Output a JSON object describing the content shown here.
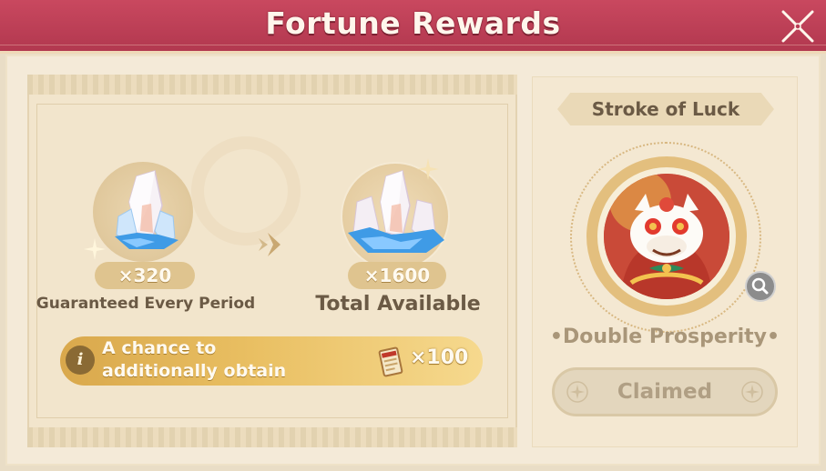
{
  "window": {
    "title": "Fortune Rewards"
  },
  "icons": {
    "close": "close-x-icon",
    "info": "info-icon",
    "arrow": "chevron-right-icon",
    "magnify": "magnifier-icon",
    "ticket": "ticket-icon",
    "crystal": "crystal-icon"
  },
  "rewards": {
    "guaranteed": {
      "amount": "×320",
      "caption": "Guaranteed Every Period"
    },
    "total": {
      "amount": "×1600",
      "caption": "Total Available"
    },
    "chance": {
      "text": "A chance to additionally obtain",
      "icon_char": "i",
      "item_amount": "×100"
    }
  },
  "bonus": {
    "banner": "Stroke of Luck",
    "item_name": "•Double Prosperity•",
    "button_label": "Claimed"
  },
  "colors": {
    "title_bar": "#b93d55",
    "background": "#f4ead8",
    "gold": "#e0c18a",
    "chance_bar": "#e9bf62"
  }
}
